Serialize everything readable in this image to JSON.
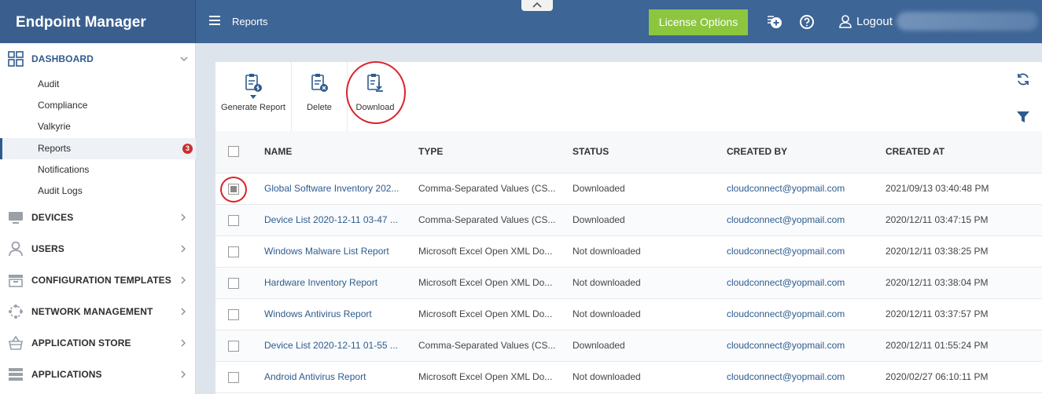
{
  "app": {
    "title": "Endpoint Manager"
  },
  "header": {
    "breadcrumb": "Reports",
    "license_label": "License Options",
    "logout_label": "Logout",
    "icons": [
      "add-notification-icon",
      "help-icon",
      "user-icon"
    ]
  },
  "sidebar": {
    "sections": [
      {
        "label": "DASHBOARD",
        "icon": "dashboard-grid-icon",
        "expanded": true
      },
      {
        "label": "DEVICES",
        "icon": "devices-icon"
      },
      {
        "label": "USERS",
        "icon": "user-icon"
      },
      {
        "label": "CONFIGURATION TEMPLATES",
        "icon": "templates-icon"
      },
      {
        "label": "NETWORK MANAGEMENT",
        "icon": "network-icon"
      },
      {
        "label": "APPLICATION STORE",
        "icon": "store-basket-icon"
      },
      {
        "label": "APPLICATIONS",
        "icon": "applications-icon"
      }
    ],
    "dashboard_items": [
      {
        "label": "Audit"
      },
      {
        "label": "Compliance"
      },
      {
        "label": "Valkyrie"
      },
      {
        "label": "Reports",
        "badge": "3",
        "selected": true
      },
      {
        "label": "Notifications"
      },
      {
        "label": "Audit Logs"
      }
    ]
  },
  "toolbar": {
    "generate_label": "Generate Report",
    "delete_label": "Delete",
    "download_label": "Download"
  },
  "table": {
    "columns": [
      "NAME",
      "TYPE",
      "STATUS",
      "CREATED BY",
      "CREATED AT"
    ],
    "rows": [
      {
        "checked": true,
        "name": "Global Software Inventory 202...",
        "type": "Comma-Separated Values (CS...",
        "status": "Downloaded",
        "created_by": "cloudconnect@yopmail.com",
        "created_at": "2021/09/13 03:40:48 PM"
      },
      {
        "checked": false,
        "name": "Device List 2020-12-11 03-47 ...",
        "type": "Comma-Separated Values (CS...",
        "status": "Downloaded",
        "created_by": "cloudconnect@yopmail.com",
        "created_at": "2020/12/11 03:47:15 PM"
      },
      {
        "checked": false,
        "name": "Windows Malware List Report",
        "type": "Microsoft Excel Open XML Do...",
        "status": "Not downloaded",
        "created_by": "cloudconnect@yopmail.com",
        "created_at": "2020/12/11 03:38:25 PM"
      },
      {
        "checked": false,
        "name": "Hardware Inventory Report",
        "type": "Microsoft Excel Open XML Do...",
        "status": "Not downloaded",
        "created_by": "cloudconnect@yopmail.com",
        "created_at": "2020/12/11 03:38:04 PM"
      },
      {
        "checked": false,
        "name": "Windows Antivirus Report",
        "type": "Microsoft Excel Open XML Do...",
        "status": "Not downloaded",
        "created_by": "cloudconnect@yopmail.com",
        "created_at": "2020/12/11 03:37:57 PM"
      },
      {
        "checked": false,
        "name": "Device List 2020-12-11 01-55 ...",
        "type": "Comma-Separated Values (CS...",
        "status": "Downloaded",
        "created_by": "cloudconnect@yopmail.com",
        "created_at": "2020/12/11 01:55:24 PM"
      },
      {
        "checked": false,
        "name": "Android Antivirus Report",
        "type": "Microsoft Excel Open XML Do...",
        "status": "Not downloaded",
        "created_by": "cloudconnect@yopmail.com",
        "created_at": "2020/02/27 06:10:11 PM"
      }
    ]
  },
  "colors": {
    "header_bg": "#3d6596",
    "license_green": "#8cc63f",
    "link_blue": "#2e5b8e",
    "badge_red": "#c9302c",
    "highlight_red": "#d9232a"
  }
}
